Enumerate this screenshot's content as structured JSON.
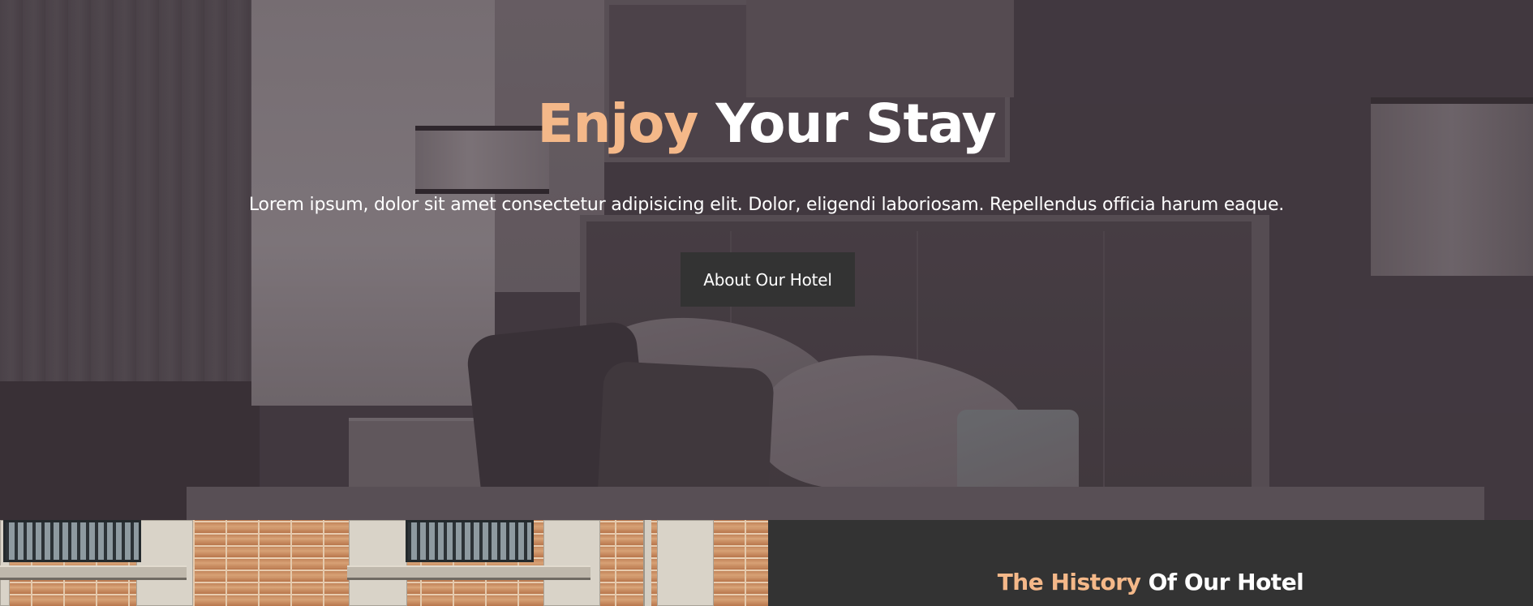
{
  "hero": {
    "title_accent": "Enjoy",
    "title_rest": "Your Stay",
    "subtitle": "Lorem ipsum, dolor sit amet consectetur adipisicing elit. Dolor, eligendi laboriosam. Repellendus officia harum eaque.",
    "button_label": "About Our Hotel"
  },
  "history": {
    "title_accent": "The History",
    "title_rest": "Of Our Hotel"
  },
  "colors": {
    "accent": "#f4b889",
    "dark_panel": "#333333",
    "text_light": "#ffffff"
  }
}
